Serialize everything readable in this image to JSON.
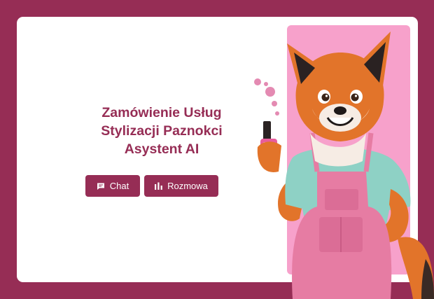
{
  "hero": {
    "title_lines": [
      "Zamówienie Usług",
      "Stylizacji Paznokci",
      "Asystent AI"
    ]
  },
  "actions": {
    "chat_label": "Chat",
    "chat_icon": "chat-bubble-icon",
    "voice_label": "Rozmowa",
    "voice_icon": "audio-bars-icon"
  },
  "colors": {
    "brand": "#962d55",
    "panel_pink": "#f7a1cb",
    "card_bg": "#ffffff"
  },
  "illustration": {
    "subject": "fox-mascot-with-nail-polish"
  }
}
